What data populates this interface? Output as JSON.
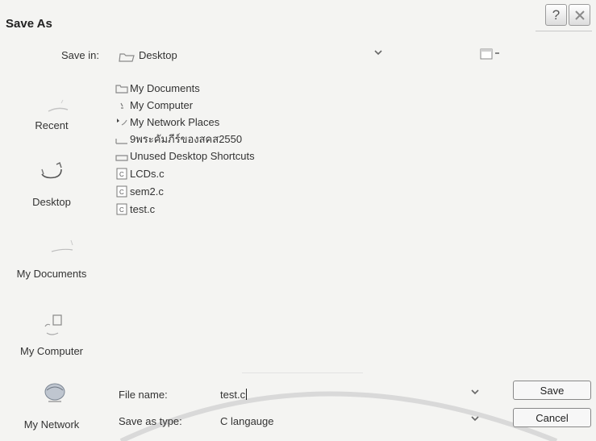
{
  "dialog": {
    "title": "Save As",
    "help_glyph": "?",
    "help_icon": "help-icon",
    "close_icon": "close-icon"
  },
  "save_in": {
    "label": "Save in:",
    "value": "Desktop",
    "icon": "folder-icon",
    "dropdown_icon": "chevron-down-icon",
    "views_icon": "views-menu-icon"
  },
  "places_bar": [
    {
      "label": "Recent",
      "icon": "recent-documents-icon"
    },
    {
      "label": "Desktop",
      "icon": "desktop-icon"
    },
    {
      "label": "My Documents",
      "icon": "my-documents-icon"
    },
    {
      "label": "My Computer",
      "icon": "my-computer-icon"
    },
    {
      "label": "My Network",
      "icon": "network-places-icon"
    }
  ],
  "file_list": [
    {
      "name": "My Documents",
      "icon": "folder-icon"
    },
    {
      "name": "My Computer",
      "icon": "computer-icon"
    },
    {
      "name": "My Network Places",
      "icon": "network-icon"
    },
    {
      "name": "9พระคัมภีร์ของสคส2550",
      "icon": "folder-icon"
    },
    {
      "name": "Unused Desktop Shortcuts",
      "icon": "folder-icon"
    },
    {
      "name": "LCDs.c",
      "icon": "c-file-icon"
    },
    {
      "name": "sem2.c",
      "icon": "c-file-icon"
    },
    {
      "name": "test.c",
      "icon": "c-file-icon"
    }
  ],
  "file_name": {
    "label": "File name:",
    "value": "test.c",
    "dropdown_icon": "chevron-down-icon"
  },
  "save_as_type": {
    "label": "Save as type:",
    "value": "C langauge",
    "dropdown_icon": "chevron-down-icon"
  },
  "buttons": {
    "save": "Save",
    "cancel": "Cancel"
  }
}
